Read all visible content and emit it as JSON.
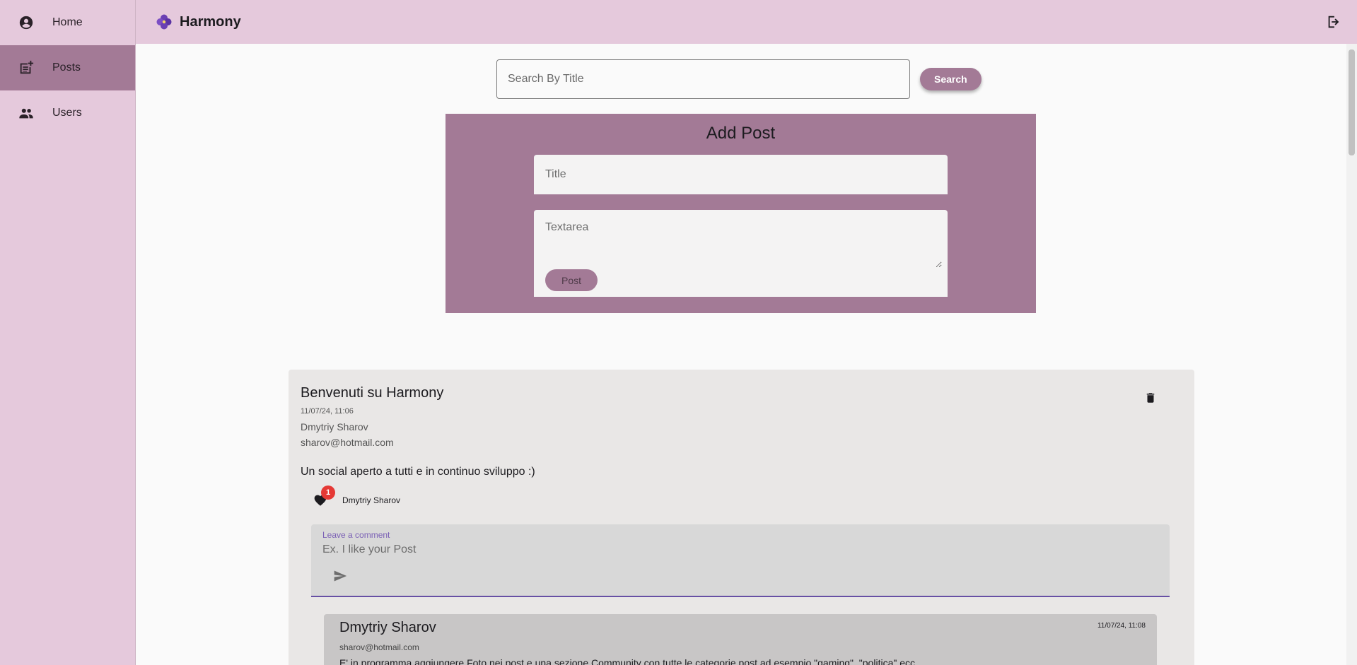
{
  "app": {
    "title": "Harmony"
  },
  "sidebar": {
    "items": [
      {
        "label": "Home",
        "icon": "account-circle-icon",
        "active": false
      },
      {
        "label": "Posts",
        "icon": "post-add-icon",
        "active": true
      },
      {
        "label": "Users",
        "icon": "people-icon",
        "active": false
      }
    ]
  },
  "header": {
    "logout_icon": "logout-icon"
  },
  "search": {
    "placeholder": "Search By Title",
    "button_label": "Search"
  },
  "add_post": {
    "heading": "Add Post",
    "title_placeholder": "Title",
    "textarea_placeholder": "Textarea",
    "post_button": "Post"
  },
  "post": {
    "title": "Benvenuti su Harmony",
    "date": "11/07/24, 11:06",
    "author": "Dmytriy Sharov",
    "email": "sharov@hotmail.com",
    "body": "Un social aperto a tutti e in continuo sviluppo :)",
    "likes_count": "1",
    "liked_by": "Dmytriy Sharov",
    "comment_label": "Leave a comment",
    "comment_placeholder": "Ex. I like your Post"
  },
  "comment": {
    "author": "Dmytriy Sharov",
    "date": "11/07/24, 11:08",
    "email": "sharov@hotmail.com",
    "text": "E' in programma aggiungere Foto nei post e una sezione Community con tutte le categorie post ad esempio \"gaming\", \"politica\" ecc"
  },
  "colors": {
    "sidebar_bg": "#e5c9dc",
    "accent": "#a37a96",
    "badge": "#e53935",
    "focus_underline": "#6750a4"
  }
}
